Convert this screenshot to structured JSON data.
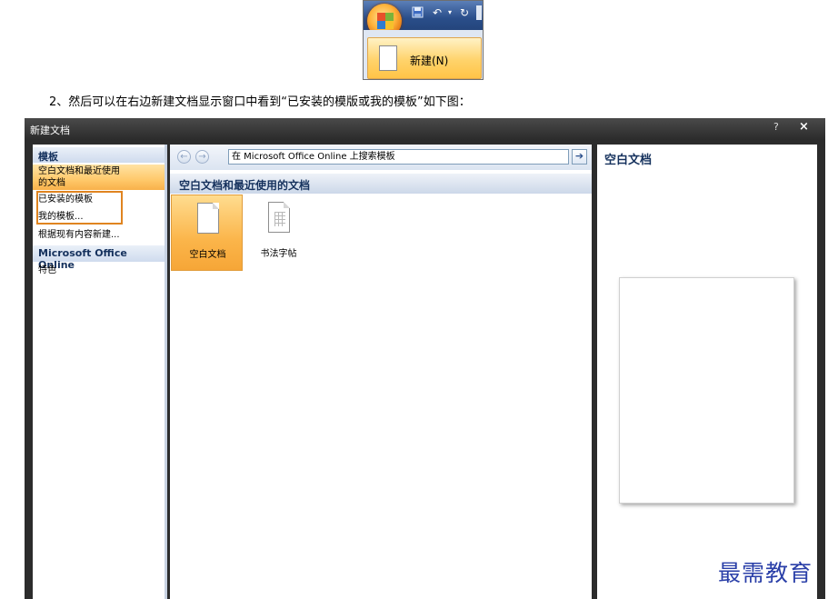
{
  "office_crop": {
    "new_menu_label": "新建(N)",
    "qat_icons": [
      "save-icon",
      "undo-icon",
      "redo-icon"
    ]
  },
  "caption": "2、然后可以在右边新建文档显示窗口中看到“已安装的模版或我的模板”如下图：",
  "dialog": {
    "title": "新建文档",
    "help_label": "?",
    "close_label": "×",
    "left_pane": {
      "templates_header": "模板",
      "blank_recent_line1": "空白文档和最近使用",
      "blank_recent_line2": "的文档",
      "installed_templates": "已安装的模板",
      "my_templates": "我的模板...",
      "new_from_existing": "根据现有内容新建...",
      "online_header": "Microsoft Office Online",
      "featured": "特色"
    },
    "middle_pane": {
      "search_text": "在 Microsoft Office Online 上搜索模板",
      "section_title": "空白文档和最近使用的文档",
      "tiles": [
        {
          "label": "空白文档",
          "selected": true
        },
        {
          "label": "书法字帖",
          "selected": false
        }
      ]
    },
    "right_pane": {
      "title": "空白文档"
    }
  },
  "watermark": "最需教育",
  "colors": {
    "accent_orange": "#e08420",
    "title_blue": "#15315d",
    "watermark_blue": "#2a3fa8"
  }
}
